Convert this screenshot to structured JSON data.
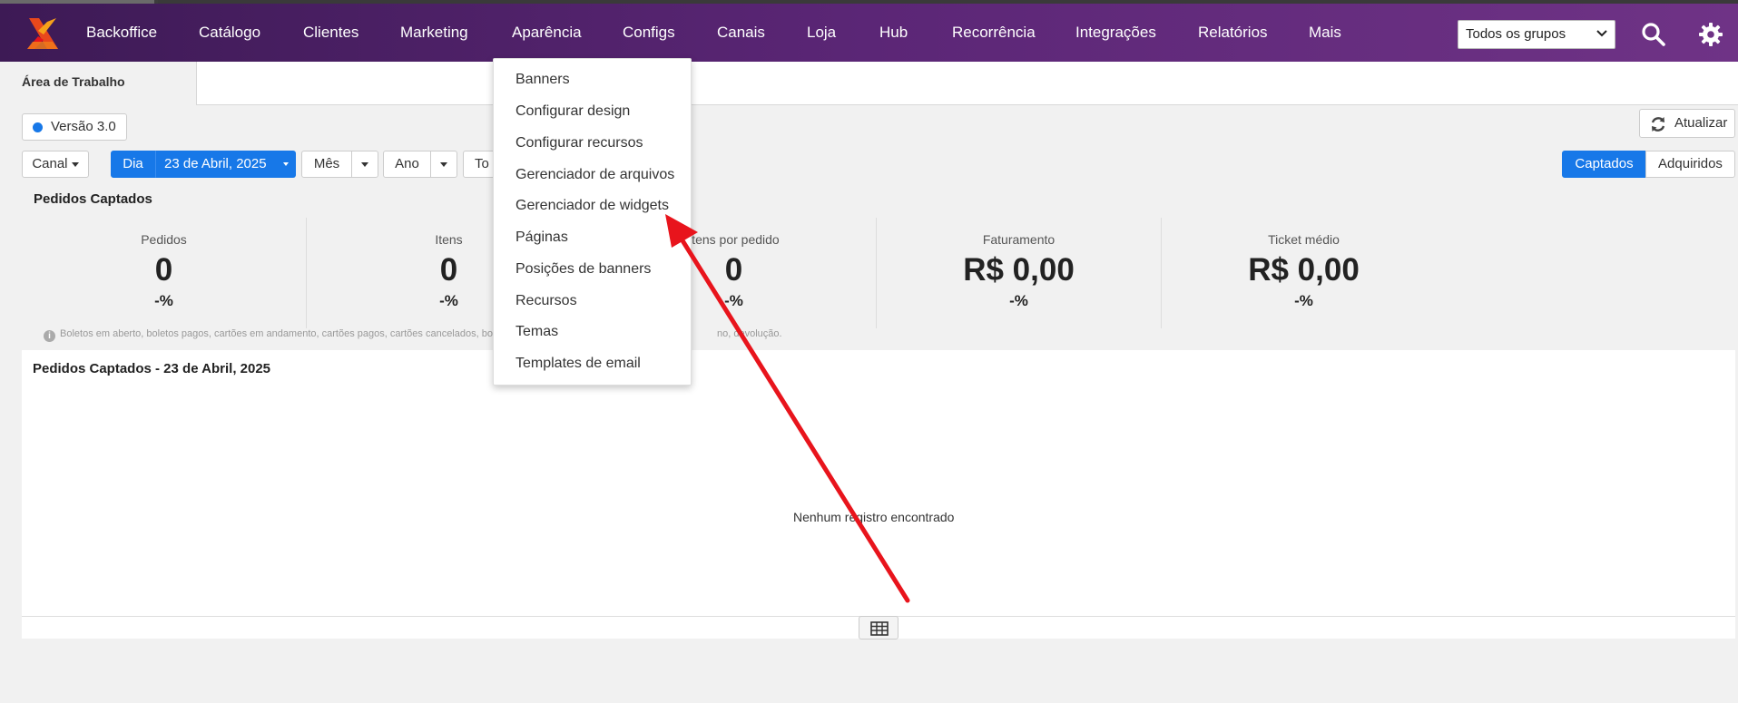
{
  "navbar": {
    "items": [
      "Backoffice",
      "Catálogo",
      "Clientes",
      "Marketing",
      "Aparência",
      "Configs",
      "Canais",
      "Loja",
      "Hub",
      "Recorrência",
      "Integrações",
      "Relatórios",
      "Mais"
    ],
    "group_select": "Todos os grupos",
    "search_icon": "search-icon",
    "settings_icon": "gear-icon",
    "bg_colors": [
      "#3d1a55",
      "#6f3386"
    ]
  },
  "tabs": {
    "active": "Área de Trabalho"
  },
  "version": {
    "label": "Versão 3.0",
    "dot_color": "#1778e8"
  },
  "update_button": "Atualizar",
  "filters": {
    "canal": "Canal",
    "dia": "Dia",
    "date": "23 de Abril, 2025",
    "mes": "Mês",
    "ano": "Ano",
    "todo": "To",
    "captados": "Captados",
    "adquiridos": "Adquiridos"
  },
  "stats": {
    "title": "Pedidos Captados",
    "items": [
      {
        "label": "Pedidos",
        "value": "0",
        "pct": "-%"
      },
      {
        "label": "Itens",
        "value": "0",
        "pct": "-%"
      },
      {
        "label": "Itens por pedido",
        "value": "0",
        "pct": "-%"
      },
      {
        "label": "Faturamento",
        "value": "R$ 0,00",
        "pct": "-%"
      },
      {
        "label": "Ticket médio",
        "value": "R$ 0,00",
        "pct": "-%"
      }
    ],
    "note_left": "Boletos em aberto, boletos pagos, cartões em andamento, cartões pagos, cartões cancelados, bo",
    "note_right": "no, devolução."
  },
  "panel": {
    "title": "Pedidos Captados - 23 de Abril, 2025",
    "empty": "Nenhum registro encontrado",
    "table_icon": "table-icon"
  },
  "dropdown": {
    "items": [
      "Banners",
      "Configurar design",
      "Configurar recursos",
      "Gerenciador de arquivos",
      "Gerenciador de widgets",
      "Páginas",
      "Posições de banners",
      "Recursos",
      "Temas",
      "Templates de email"
    ]
  },
  "accent_colors": {
    "primary": "#1778e8",
    "arrow": "#e8141c"
  }
}
